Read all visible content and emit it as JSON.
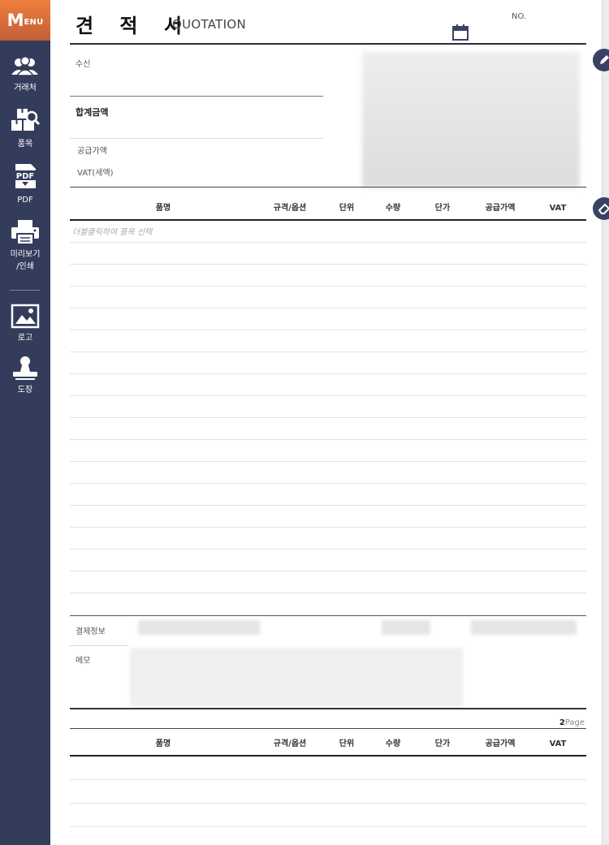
{
  "sidebar": {
    "menu": {
      "big": "M",
      "small": "ENU"
    },
    "items": [
      {
        "label": "거래처"
      },
      {
        "label": "품목"
      },
      {
        "label": "PDF"
      },
      {
        "label": "미리보기\n/인쇄"
      },
      {
        "label": "로고"
      },
      {
        "label": "도장"
      }
    ],
    "pdf_icon_text": "PDF"
  },
  "document": {
    "title": "견 적 서",
    "subtitle": "QUOTATION",
    "no_label": "NO.",
    "recipient_label": "수신",
    "total_label": "합계금액",
    "supply_label": "공급가액",
    "vat_label": "VAT(세액)"
  },
  "items_table": {
    "columns": [
      "품명",
      "규격/옵션",
      "단위",
      "수량",
      "단가",
      "공급가액",
      "VAT"
    ],
    "placeholder": "더블클릭하여 품목 선택"
  },
  "footer": {
    "payment_label": "결제정보",
    "memo_label": "메모"
  },
  "page2": {
    "page_number": "2",
    "page_suffix": "Page",
    "columns": [
      "품명",
      "규격/옵션",
      "단위",
      "수량",
      "단가",
      "공급가액",
      "VAT"
    ]
  },
  "colors": {
    "sidebar_bg": "#343c5b",
    "menu_accent": "#ef7e3f"
  }
}
